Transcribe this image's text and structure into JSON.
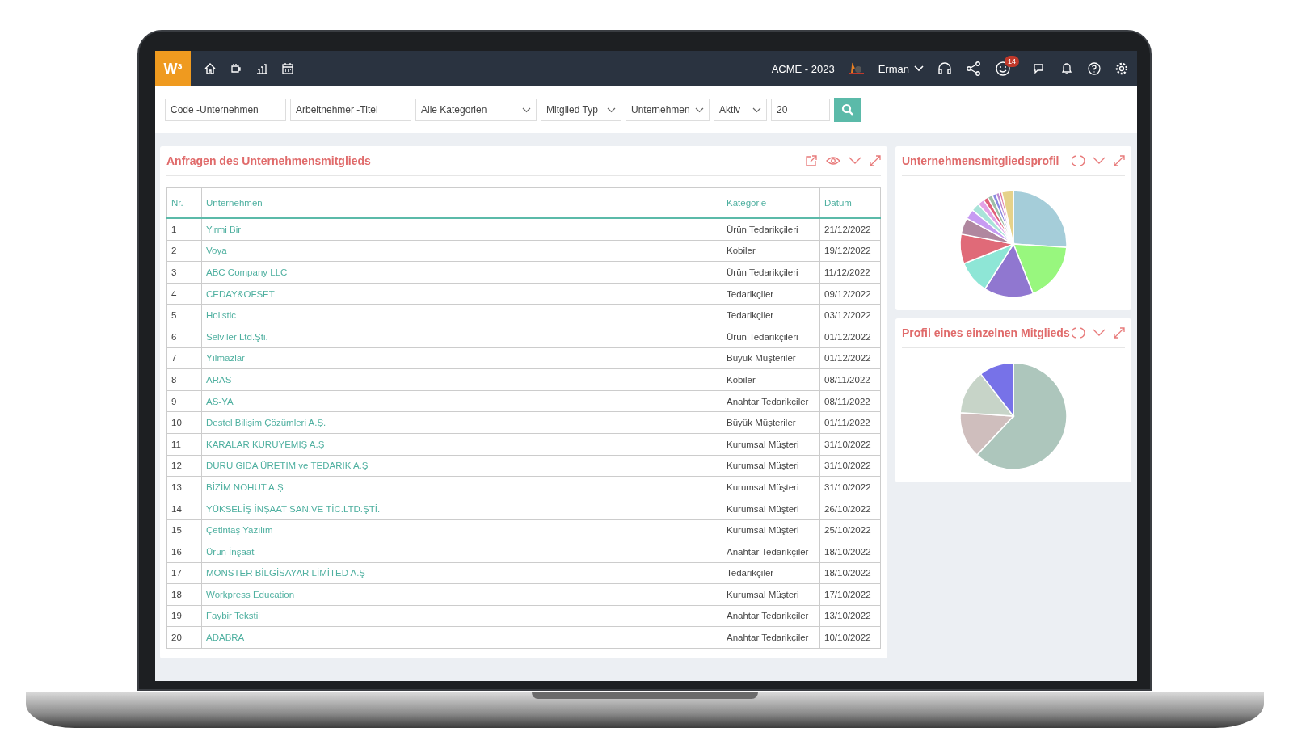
{
  "topbar": {
    "logo": "W³",
    "company": "ACME - 2023",
    "user": "Erman",
    "notification_count": "14"
  },
  "filters": [
    {
      "kind": "text",
      "placeholder": "Code -Unternehmen"
    },
    {
      "kind": "text",
      "placeholder": "Arbeitnehmer -Titel"
    },
    {
      "kind": "select",
      "value": "Alle Kategorien"
    },
    {
      "kind": "select",
      "value": "Mitglied Typ"
    },
    {
      "kind": "select",
      "value": "Unternehmen"
    },
    {
      "kind": "select",
      "value": "Aktiv"
    },
    {
      "kind": "text",
      "value": "20"
    }
  ],
  "requests_panel": {
    "title": "Anfragen des Unternehmensmitglieds",
    "table": {
      "columns": [
        "Nr.",
        "Unternehmen",
        "Kategorie",
        "Datum"
      ],
      "rows": [
        [
          "1",
          "Yirmi Bir",
          "Ürün Tedarikçileri",
          "21/12/2022"
        ],
        [
          "2",
          "Voya",
          "Kobiler",
          "19/12/2022"
        ],
        [
          "3",
          "ABC Company LLC",
          "Ürün Tedarikçileri",
          "11/12/2022"
        ],
        [
          "4",
          "CEDAY&OFSET",
          "Tedarikçiler",
          "09/12/2022"
        ],
        [
          "5",
          "Holistic",
          "Tedarikçiler",
          "03/12/2022"
        ],
        [
          "6",
          "Selviler Ltd.Şti.",
          "Ürün Tedarikçileri",
          "01/12/2022"
        ],
        [
          "7",
          "Yılmazlar",
          "Büyük Müşteriler",
          "01/12/2022"
        ],
        [
          "8",
          "ARAS",
          "Kobiler",
          "08/11/2022"
        ],
        [
          "9",
          "AS-YA",
          "Anahtar Tedarikçiler",
          "08/11/2022"
        ],
        [
          "10",
          "Destel Bilişim Çözümleri A.Ş.",
          "Büyük Müşteriler",
          "01/11/2022"
        ],
        [
          "11",
          "KARALAR KURUYEMİŞ A.Ş",
          "Kurumsal Müşteri",
          "31/10/2022"
        ],
        [
          "12",
          "DURU GIDA ÜRETİM ve TEDARİK A.Ş",
          "Kurumsal Müşteri",
          "31/10/2022"
        ],
        [
          "13",
          "BİZİM NOHUT A.Ş",
          "Kurumsal Müşteri",
          "31/10/2022"
        ],
        [
          "14",
          "YÜKSELİŞ İNŞAAT SAN.VE TİC.LTD.ŞTİ.",
          "Kurumsal Müşteri",
          "26/10/2022"
        ],
        [
          "15",
          "Çetintaş Yazılım",
          "Kurumsal Müşteri",
          "25/10/2022"
        ],
        [
          "16",
          "Ürün İnşaat",
          "Anahtar Tedarikçiler",
          "18/10/2022"
        ],
        [
          "17",
          "MONSTER BİLGİSAYAR LİMİTED A.Ş",
          "Tedarikçiler",
          "18/10/2022"
        ],
        [
          "18",
          "Workpress Education",
          "Kurumsal Müşteri",
          "17/10/2022"
        ],
        [
          "19",
          "Faybir Tekstil",
          "Anahtar Tedarikçiler",
          "13/10/2022"
        ],
        [
          "20",
          "ADABRA",
          "Anahtar Tedarikçiler",
          "10/10/2022"
        ]
      ]
    }
  },
  "chart_panels": [
    {
      "title": "Unternehmensmitgliedsprofil"
    },
    {
      "title": "Profil eines einzelnen Mitglieds"
    }
  ]
}
